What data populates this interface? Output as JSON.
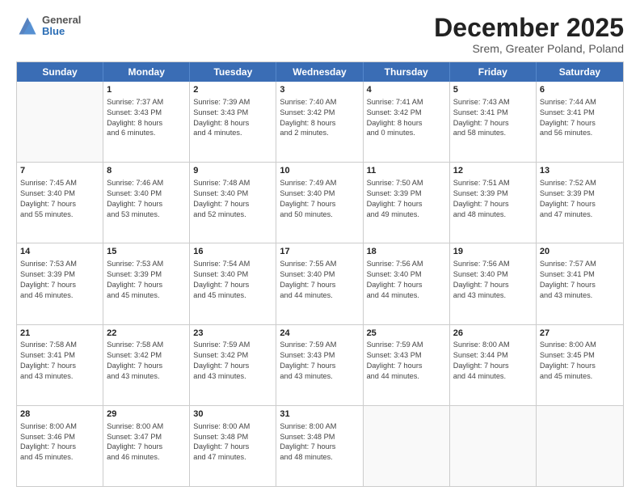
{
  "header": {
    "logo": {
      "general": "General",
      "blue": "Blue"
    },
    "title": "December 2025",
    "location": "Srem, Greater Poland, Poland"
  },
  "weekdays": [
    "Sunday",
    "Monday",
    "Tuesday",
    "Wednesday",
    "Thursday",
    "Friday",
    "Saturday"
  ],
  "weeks": [
    [
      {
        "day": "",
        "lines": []
      },
      {
        "day": "1",
        "lines": [
          "Sunrise: 7:37 AM",
          "Sunset: 3:43 PM",
          "Daylight: 8 hours",
          "and 6 minutes."
        ]
      },
      {
        "day": "2",
        "lines": [
          "Sunrise: 7:39 AM",
          "Sunset: 3:43 PM",
          "Daylight: 8 hours",
          "and 4 minutes."
        ]
      },
      {
        "day": "3",
        "lines": [
          "Sunrise: 7:40 AM",
          "Sunset: 3:42 PM",
          "Daylight: 8 hours",
          "and 2 minutes."
        ]
      },
      {
        "day": "4",
        "lines": [
          "Sunrise: 7:41 AM",
          "Sunset: 3:42 PM",
          "Daylight: 8 hours",
          "and 0 minutes."
        ]
      },
      {
        "day": "5",
        "lines": [
          "Sunrise: 7:43 AM",
          "Sunset: 3:41 PM",
          "Daylight: 7 hours",
          "and 58 minutes."
        ]
      },
      {
        "day": "6",
        "lines": [
          "Sunrise: 7:44 AM",
          "Sunset: 3:41 PM",
          "Daylight: 7 hours",
          "and 56 minutes."
        ]
      }
    ],
    [
      {
        "day": "7",
        "lines": [
          "Sunrise: 7:45 AM",
          "Sunset: 3:40 PM",
          "Daylight: 7 hours",
          "and 55 minutes."
        ]
      },
      {
        "day": "8",
        "lines": [
          "Sunrise: 7:46 AM",
          "Sunset: 3:40 PM",
          "Daylight: 7 hours",
          "and 53 minutes."
        ]
      },
      {
        "day": "9",
        "lines": [
          "Sunrise: 7:48 AM",
          "Sunset: 3:40 PM",
          "Daylight: 7 hours",
          "and 52 minutes."
        ]
      },
      {
        "day": "10",
        "lines": [
          "Sunrise: 7:49 AM",
          "Sunset: 3:40 PM",
          "Daylight: 7 hours",
          "and 50 minutes."
        ]
      },
      {
        "day": "11",
        "lines": [
          "Sunrise: 7:50 AM",
          "Sunset: 3:39 PM",
          "Daylight: 7 hours",
          "and 49 minutes."
        ]
      },
      {
        "day": "12",
        "lines": [
          "Sunrise: 7:51 AM",
          "Sunset: 3:39 PM",
          "Daylight: 7 hours",
          "and 48 minutes."
        ]
      },
      {
        "day": "13",
        "lines": [
          "Sunrise: 7:52 AM",
          "Sunset: 3:39 PM",
          "Daylight: 7 hours",
          "and 47 minutes."
        ]
      }
    ],
    [
      {
        "day": "14",
        "lines": [
          "Sunrise: 7:53 AM",
          "Sunset: 3:39 PM",
          "Daylight: 7 hours",
          "and 46 minutes."
        ]
      },
      {
        "day": "15",
        "lines": [
          "Sunrise: 7:53 AM",
          "Sunset: 3:39 PM",
          "Daylight: 7 hours",
          "and 45 minutes."
        ]
      },
      {
        "day": "16",
        "lines": [
          "Sunrise: 7:54 AM",
          "Sunset: 3:40 PM",
          "Daylight: 7 hours",
          "and 45 minutes."
        ]
      },
      {
        "day": "17",
        "lines": [
          "Sunrise: 7:55 AM",
          "Sunset: 3:40 PM",
          "Daylight: 7 hours",
          "and 44 minutes."
        ]
      },
      {
        "day": "18",
        "lines": [
          "Sunrise: 7:56 AM",
          "Sunset: 3:40 PM",
          "Daylight: 7 hours",
          "and 44 minutes."
        ]
      },
      {
        "day": "19",
        "lines": [
          "Sunrise: 7:56 AM",
          "Sunset: 3:40 PM",
          "Daylight: 7 hours",
          "and 43 minutes."
        ]
      },
      {
        "day": "20",
        "lines": [
          "Sunrise: 7:57 AM",
          "Sunset: 3:41 PM",
          "Daylight: 7 hours",
          "and 43 minutes."
        ]
      }
    ],
    [
      {
        "day": "21",
        "lines": [
          "Sunrise: 7:58 AM",
          "Sunset: 3:41 PM",
          "Daylight: 7 hours",
          "and 43 minutes."
        ]
      },
      {
        "day": "22",
        "lines": [
          "Sunrise: 7:58 AM",
          "Sunset: 3:42 PM",
          "Daylight: 7 hours",
          "and 43 minutes."
        ]
      },
      {
        "day": "23",
        "lines": [
          "Sunrise: 7:59 AM",
          "Sunset: 3:42 PM",
          "Daylight: 7 hours",
          "and 43 minutes."
        ]
      },
      {
        "day": "24",
        "lines": [
          "Sunrise: 7:59 AM",
          "Sunset: 3:43 PM",
          "Daylight: 7 hours",
          "and 43 minutes."
        ]
      },
      {
        "day": "25",
        "lines": [
          "Sunrise: 7:59 AM",
          "Sunset: 3:43 PM",
          "Daylight: 7 hours",
          "and 44 minutes."
        ]
      },
      {
        "day": "26",
        "lines": [
          "Sunrise: 8:00 AM",
          "Sunset: 3:44 PM",
          "Daylight: 7 hours",
          "and 44 minutes."
        ]
      },
      {
        "day": "27",
        "lines": [
          "Sunrise: 8:00 AM",
          "Sunset: 3:45 PM",
          "Daylight: 7 hours",
          "and 45 minutes."
        ]
      }
    ],
    [
      {
        "day": "28",
        "lines": [
          "Sunrise: 8:00 AM",
          "Sunset: 3:46 PM",
          "Daylight: 7 hours",
          "and 45 minutes."
        ]
      },
      {
        "day": "29",
        "lines": [
          "Sunrise: 8:00 AM",
          "Sunset: 3:47 PM",
          "Daylight: 7 hours",
          "and 46 minutes."
        ]
      },
      {
        "day": "30",
        "lines": [
          "Sunrise: 8:00 AM",
          "Sunset: 3:48 PM",
          "Daylight: 7 hours",
          "and 47 minutes."
        ]
      },
      {
        "day": "31",
        "lines": [
          "Sunrise: 8:00 AM",
          "Sunset: 3:48 PM",
          "Daylight: 7 hours",
          "and 48 minutes."
        ]
      },
      {
        "day": "",
        "lines": []
      },
      {
        "day": "",
        "lines": []
      },
      {
        "day": "",
        "lines": []
      }
    ]
  ]
}
